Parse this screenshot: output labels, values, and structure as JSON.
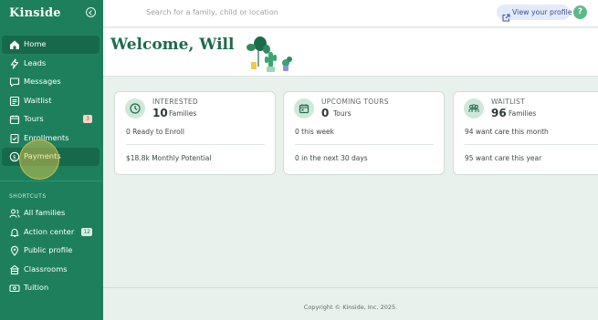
{
  "sidebar": {
    "brand": "Kinside",
    "nav": [
      {
        "label": "Home",
        "icon": "home-icon",
        "active": true
      },
      {
        "label": "Leads",
        "icon": "bolt-icon"
      },
      {
        "label": "Messages",
        "icon": "chat-icon"
      },
      {
        "label": "Waitlist",
        "icon": "list-icon"
      },
      {
        "label": "Tours",
        "icon": "calendar-icon",
        "badge": "3"
      },
      {
        "label": "Enrollments",
        "icon": "enroll-icon"
      },
      {
        "label": "Payments",
        "icon": "dollar-icon"
      }
    ],
    "shortcuts_title": "SHORTCUTS",
    "shortcuts": [
      {
        "label": "All families",
        "icon": "people-icon"
      },
      {
        "label": "Action center",
        "icon": "bell-icon",
        "badge": "12"
      },
      {
        "label": "Public profile",
        "icon": "location-pin-icon"
      },
      {
        "label": "Classrooms",
        "icon": "building-icon"
      },
      {
        "label": "Tuition",
        "icon": "money-icon"
      }
    ]
  },
  "topbar": {
    "search_placeholder": "Search for a family, child or location",
    "profile_label": "View your profile",
    "help_label": "?"
  },
  "welcome": {
    "title": "Welcome, Will"
  },
  "cards": [
    {
      "title": "INTERESTED",
      "count": "10",
      "unit": "Families",
      "line1": "0 Ready to Enroll",
      "line2": "$18.8k Monthly Potential",
      "icon": "clock-icon"
    },
    {
      "title": "UPCOMING TOURS",
      "count": "0",
      "unit": "Tours",
      "line1": "0 this week",
      "line2": "0 in the next 30 days",
      "icon": "calendar-icon"
    },
    {
      "title": "WAITLIST",
      "count": "96",
      "unit": "Families",
      "line1": "94 want care this month",
      "line2": "95 want care this year",
      "icon": "group-icon"
    }
  ],
  "footer": {
    "copyright": "Copyright © Kinside, Inc. 2025."
  },
  "colors": {
    "sidebar": "#1e7f5c",
    "accent_green": "#1c6b4d",
    "background": "#e9f1ec"
  }
}
